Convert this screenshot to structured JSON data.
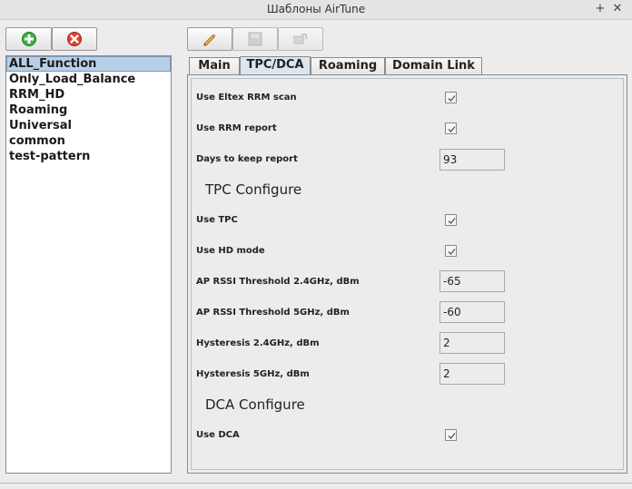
{
  "window": {
    "title": "Шаблоны AirTune",
    "pin_icon": "+",
    "close_icon": "✕"
  },
  "left_toolbar": {
    "add_icon": "add-icon",
    "remove_icon": "remove-icon"
  },
  "right_toolbar": {
    "edit_icon": "pencil-icon",
    "save_icon": "save-icon",
    "apply_icon": "apply-icon"
  },
  "templates": [
    "ALL_Function",
    "Only_Load_Balance",
    "RRM_HD",
    "Roaming",
    "Universal",
    "common",
    "test-pattern"
  ],
  "selected_template": "ALL_Function",
  "tabs": [
    "Main",
    "TPC/DCA",
    "Roaming",
    "Domain Link"
  ],
  "active_tab": "TPC/DCA",
  "form": {
    "use_eltex_rrm_scan": {
      "label": "Use Eltex RRM scan",
      "checked": true
    },
    "use_rrm_report": {
      "label": "Use RRM report",
      "checked": true
    },
    "days_to_keep_report": {
      "label": "Days to keep report",
      "value": "93"
    },
    "tpc_header": "TPC Configure",
    "use_tpc": {
      "label": "Use TPC",
      "checked": true
    },
    "use_hd_mode": {
      "label": "Use HD mode",
      "checked": true
    },
    "ap_rssi_24": {
      "label": "AP RSSI Threshold 2.4GHz, dBm",
      "value": "-65"
    },
    "ap_rssi_5": {
      "label": "AP RSSI Threshold 5GHz, dBm",
      "value": "-60"
    },
    "hyst_24": {
      "label": "Hysteresis 2.4GHz, dBm",
      "value": "2"
    },
    "hyst_5": {
      "label": "Hysteresis 5GHz, dBm",
      "value": "2"
    },
    "dca_header": "DCA Configure",
    "use_dca": {
      "label": "Use DCA",
      "checked": true
    }
  },
  "colors": {
    "selection": "#b8cfe5",
    "add_green": "#3cb043",
    "remove_red": "#e04030"
  }
}
